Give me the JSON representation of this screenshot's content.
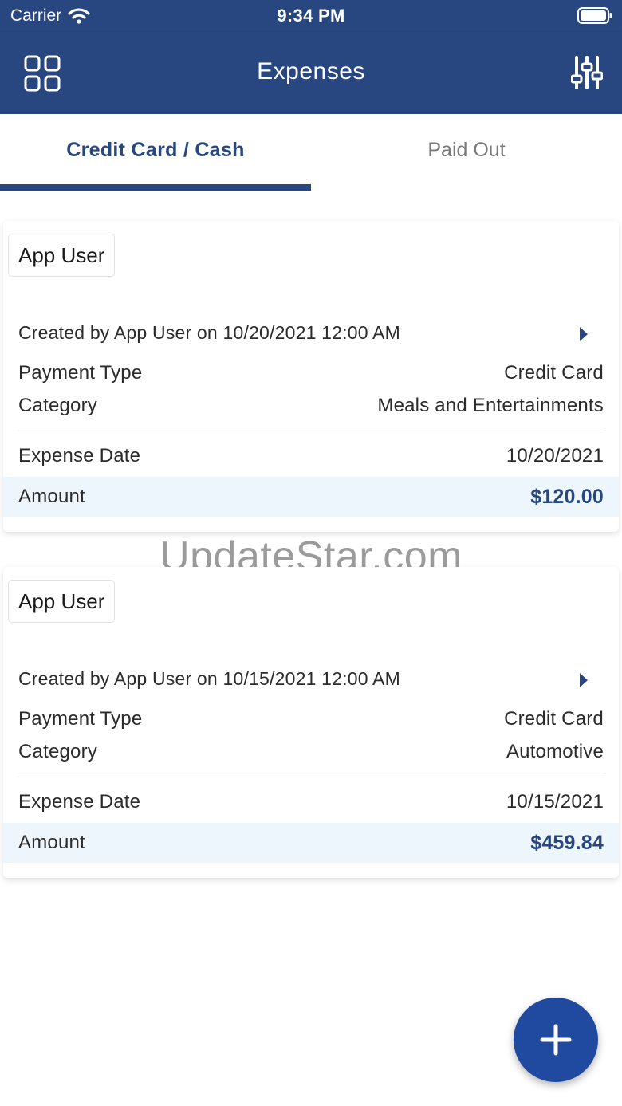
{
  "status_bar": {
    "carrier": "Carrier",
    "time": "9:34 PM",
    "icons": [
      "wifi-icon",
      "battery-icon"
    ]
  },
  "header": {
    "title": "Expenses",
    "left_icon": "grid-menu-icon",
    "right_icon": "filter-sliders-icon"
  },
  "tabs": [
    {
      "label": "Credit Card / Cash",
      "active": true
    },
    {
      "label": "Paid Out",
      "active": false
    }
  ],
  "watermark": "UpdateStar.com",
  "expenses": [
    {
      "user": "App User",
      "created": "Created by App User on 10/20/2021 12:00 AM",
      "payment_type_label": "Payment Type",
      "payment_type": "Credit Card",
      "category_label": "Category",
      "category": "Meals and Entertainments",
      "expense_date_label": "Expense Date",
      "expense_date": "10/20/2021",
      "amount_label": "Amount",
      "amount": "$120.00"
    },
    {
      "user": "App User",
      "created": "Created by App User on 10/15/2021 12:00 AM",
      "payment_type_label": "Payment Type",
      "payment_type": "Credit Card",
      "category_label": "Category",
      "category": "Automotive",
      "expense_date_label": "Expense Date",
      "expense_date": "10/15/2021",
      "amount_label": "Amount",
      "amount": "$459.84"
    }
  ],
  "fab": {
    "icon": "plus-icon"
  },
  "colors": {
    "primary": "#284781",
    "fab": "#1f4aa0",
    "amount_band": "#eef6fd"
  }
}
